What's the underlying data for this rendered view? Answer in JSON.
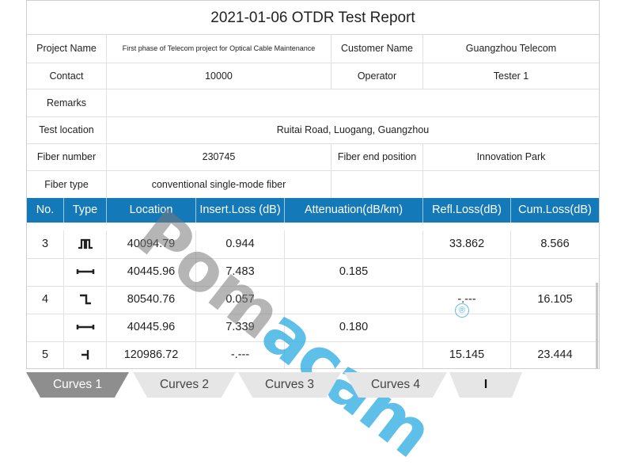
{
  "report": {
    "title": "2021-01-06 OTDR Test Report",
    "info": {
      "project_name_label": "Project Name",
      "project_name_value": "First phase of Telecom project for Optical Cable Maintenance",
      "customer_name_label": "Customer Name",
      "customer_name_value": "Guangzhou Telecom",
      "contact_label": "Contact",
      "contact_value": "10000",
      "operator_label": "Operator",
      "operator_value": "Tester 1",
      "remarks_label": "Remarks",
      "remarks_value": "",
      "test_location_label": "Test location",
      "test_location_value": "Ruitai Road, Luogang, Guangzhou",
      "fiber_number_label": "Fiber number",
      "fiber_number_value": "230745",
      "fiber_end_position_label": "Fiber end position",
      "fiber_end_position_value": "Innovation Park",
      "fiber_type_label": "Fiber type",
      "fiber_type_value": "conventional single-mode fiber"
    },
    "columns": [
      "No.",
      "Type",
      "Location",
      "Insert.Loss (dB)",
      "Attenuation(dB/km)",
      "Refl.Loss(dB)",
      "Cum.Loss(dB)"
    ],
    "rows": [
      {
        "no": "3",
        "type_icon": "reflective-event-icon",
        "location": "40094.79",
        "insert_loss": "0.944",
        "attenuation": "",
        "refl_loss": "33.862",
        "cum_loss": "8.566"
      },
      {
        "no": "",
        "type_icon": "fiber-section-icon",
        "location": "40445.96",
        "insert_loss": "7.483",
        "attenuation": "0.185",
        "refl_loss": "",
        "cum_loss": ""
      },
      {
        "no": "4",
        "type_icon": "non-reflective-event-icon",
        "location": "80540.76",
        "insert_loss": "0.057",
        "attenuation": "",
        "refl_loss": "-.---",
        "cum_loss": "16.105"
      },
      {
        "no": "",
        "type_icon": "fiber-section-icon",
        "location": "40445.96",
        "insert_loss": "7.339",
        "attenuation": "0.180",
        "refl_loss": "",
        "cum_loss": ""
      },
      {
        "no": "5",
        "type_icon": "fiber-end-icon",
        "location": "120986.72",
        "insert_loss": "-.---",
        "attenuation": "",
        "refl_loss": "15.145",
        "cum_loss": "23.444"
      }
    ]
  },
  "watermark": {
    "part1": "Pom",
    "part2": "acam"
  },
  "tabs": [
    {
      "label": "Curves 1",
      "active": true
    },
    {
      "label": "Curves 2",
      "active": false
    },
    {
      "label": "Curves 3",
      "active": false
    },
    {
      "label": "Curves 4",
      "active": false
    },
    {
      "label": "I",
      "active": false
    }
  ],
  "colors": {
    "header_bg": "#1479b8",
    "tab_active": "#8e8e8e",
    "tab_inactive": "#e6e6e6",
    "watermark_blue": "#28aae1"
  }
}
